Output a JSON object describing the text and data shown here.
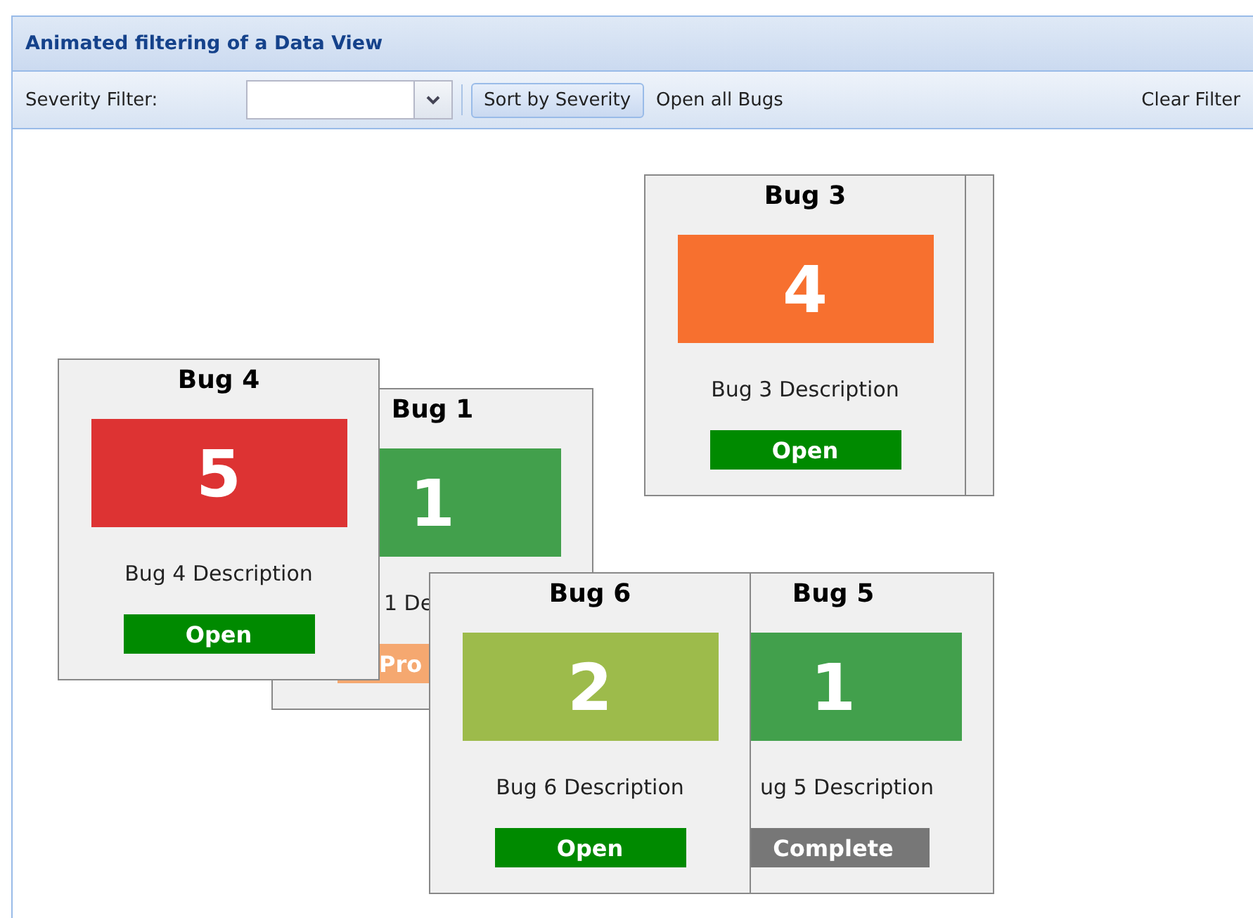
{
  "panel": {
    "title": "Animated filtering of a Data View"
  },
  "toolbar": {
    "filter_label": "Severity Filter:",
    "sort_button": "Sort by Severity",
    "open_all_button": "Open all Bugs",
    "clear_button": "Clear Filter"
  },
  "cards": [
    {
      "kind": "edge"
    },
    {
      "kind": "card",
      "title": "Bug 3",
      "severity": {
        "value": "4",
        "color": "#f7702f"
      },
      "description": "Bug 3 Description",
      "status": {
        "label": "Open",
        "color": "#008a00"
      }
    },
    {
      "kind": "card",
      "title": "Bug 4",
      "severity": {
        "value": "5",
        "color": "#dd3333"
      },
      "description": "Bug 4 Description",
      "status": {
        "label": "Open",
        "color": "#008a00"
      }
    },
    {
      "kind": "card",
      "title": "Bug 1",
      "severity": {
        "value": "1",
        "color": "#42a04c"
      },
      "description": "1 De",
      "status": {
        "label": "Pro",
        "color": "#f5a870"
      }
    },
    {
      "kind": "card",
      "title": "Bug 6",
      "severity": {
        "value": "2",
        "color": "#9dbb4b"
      },
      "description": "Bug 6 Description",
      "status": {
        "label": "Open",
        "color": "#008a00"
      }
    },
    {
      "kind": "card",
      "title": "Bug 5",
      "severity": {
        "value": "1",
        "color": "#42a04c"
      },
      "description": "ug 5 Description",
      "status": {
        "label": "Complete",
        "color": "#777777"
      }
    }
  ]
}
